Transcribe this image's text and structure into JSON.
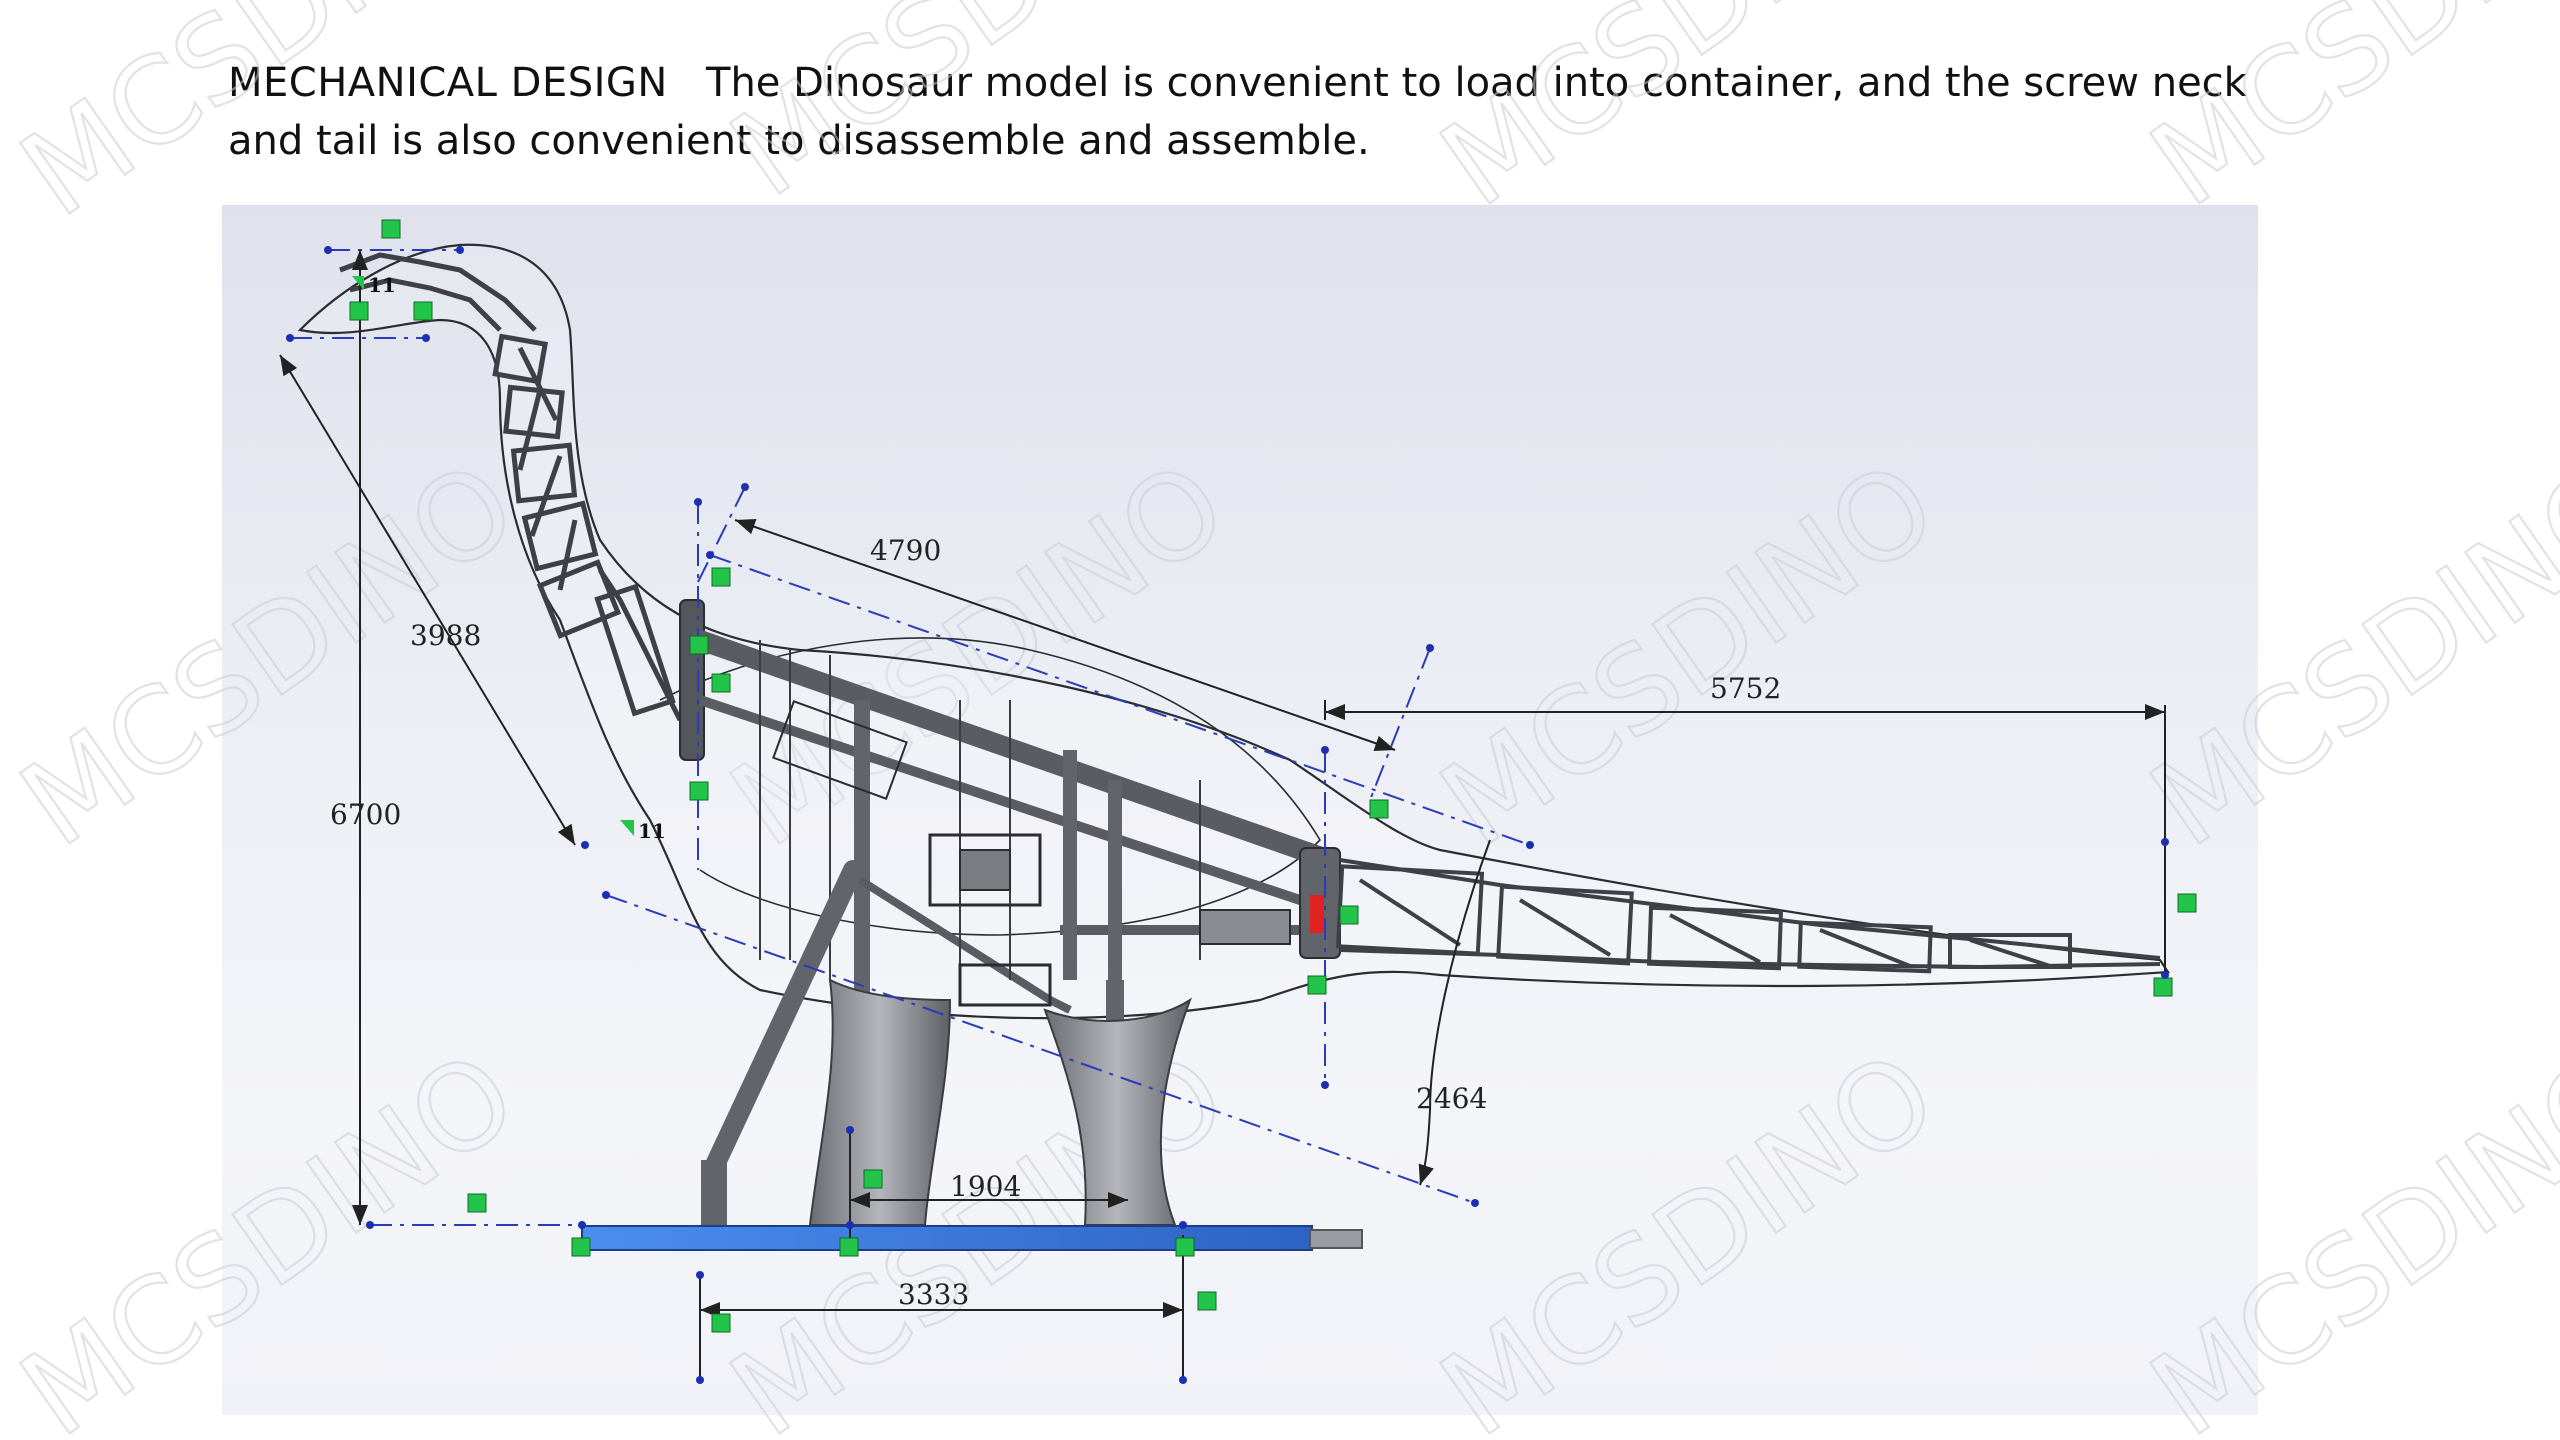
{
  "caption": {
    "title": "MECHANICAL  DESIGN",
    "text": "The Dinosaur model is convenient to load into container, and the screw neck and tail  is also convenient to disassemble and assemble."
  },
  "watermark": "MCSDINO",
  "dimensions": {
    "overall_height": "6700",
    "neck_length": "3988",
    "body_length": "4790",
    "tail_length": "5752",
    "tail_drop": "2464",
    "leg_spacing": "1904",
    "base_length": "3333",
    "angle_top": "11",
    "angle_neck": "11"
  },
  "colors": {
    "frame": "#4a4c52",
    "base_plate": "#3f7fe0",
    "marker": "#22c44a",
    "centerline": "#2a3cb8",
    "legs": "#8a8c92"
  }
}
